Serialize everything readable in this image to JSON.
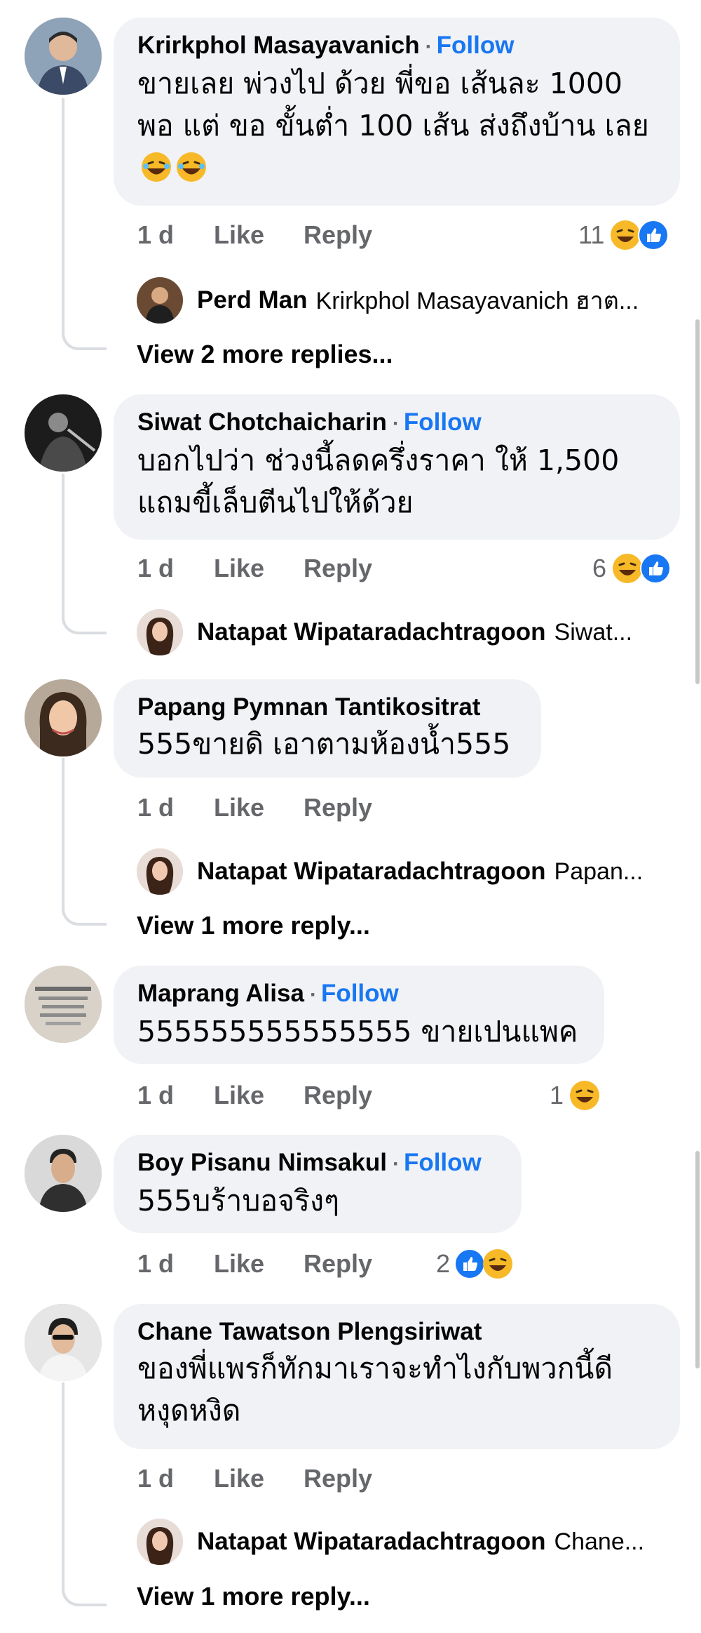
{
  "comments": [
    {
      "author": "Krirkphol Masayavanich",
      "follow": "Follow",
      "text": "ขายเลย พ่วงไป ด้วย พี่ขอ เส้นละ 1000 พอ แต่ ขอ ขั้นต่ำ 100 เส้น ส่งถึงบ้าน เลย",
      "time": "1 d",
      "like": "Like",
      "reply": "Reply",
      "reaction_count": "11",
      "reply_preview": {
        "author": "Perd Man",
        "snippet": "Krirkphol Masayavanich ฮาต..."
      },
      "more_replies": "View 2 more replies..."
    },
    {
      "author": "Siwat Chotchaicharin",
      "follow": "Follow",
      "text": "บอกไปว่า ช่วงนี้ลดครึ่งราคา ให้ 1,500 แถมขี้เล็บตีนไปให้ด้วย",
      "time": "1 d",
      "like": "Like",
      "reply": "Reply",
      "reaction_count": "6",
      "reply_preview": {
        "author": "Natapat Wipataradachtragoon",
        "snippet": "Siwat..."
      }
    },
    {
      "author": "Papang Pymnan Tantikositrat",
      "text": "555ขายดิ เอาตามห้องน้ำ555",
      "time": "1 d",
      "like": "Like",
      "reply": "Reply",
      "reply_preview": {
        "author": "Natapat Wipataradachtragoon",
        "snippet": "Papan..."
      },
      "more_replies": "View 1 more reply..."
    },
    {
      "author": "Maprang Alisa",
      "follow": "Follow",
      "text": "555555555555555 ขายเปนแพค",
      "time": "1 d",
      "like": "Like",
      "reply": "Reply",
      "reaction_count": "1"
    },
    {
      "author": "Boy Pisanu Nimsakul",
      "follow": "Follow",
      "text": "555บร้าบอจริงๆ",
      "time": "1 d",
      "like": "Like",
      "reply": "Reply",
      "reaction_count": "2"
    },
    {
      "author": "Chane Tawatson Plengsiriwat",
      "text": "ของพี่แพรก็ทักมาเราจะทำไงกับพวกนี้ดี หงุดหงิด",
      "time": "1 d",
      "like": "Like",
      "reply": "Reply",
      "reply_preview": {
        "author": "Natapat Wipataradachtragoon",
        "snippet": "Chane..."
      },
      "more_replies": "View 1 more reply..."
    }
  ],
  "colors": {
    "follow": "#1877f2",
    "bubble": "#f0f2f5",
    "meta": "#65676b",
    "haha": "#f7b928",
    "like": "#1877f2"
  },
  "icons": {
    "haha": "haha-reaction-icon",
    "like": "like-reaction-icon"
  }
}
